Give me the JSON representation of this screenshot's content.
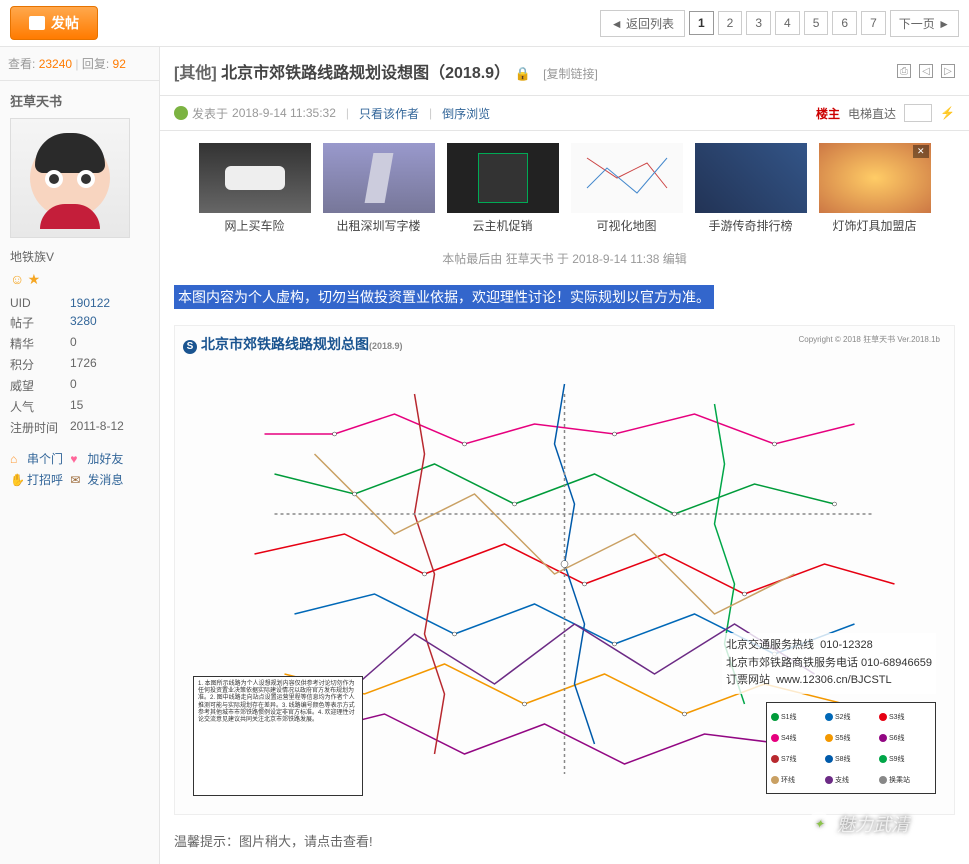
{
  "topbar": {
    "post_button": "发帖",
    "back_list": "◄ 返回列表",
    "pages": [
      "1",
      "2",
      "3",
      "4",
      "5",
      "6",
      "7"
    ],
    "next_page": "下一页 ►"
  },
  "stats": {
    "view_label": "查看:",
    "view_count": "23240",
    "reply_label": "回复:",
    "reply_count": "92"
  },
  "thread": {
    "category": "[其他]",
    "title": "北京市郊铁路线路规划设想图（2018.9）",
    "copy_link": "[复制链接]",
    "posted_prefix": "发表于",
    "posted_time": "2018-9-14 11:35:32",
    "only_author": "只看该作者",
    "reverse": "倒序浏览",
    "floor_master": "楼主",
    "elevator": "电梯直达",
    "edit_note": "本帖最后由 狂草天书 于 2018-9-14 11:38 编辑"
  },
  "user": {
    "name": "狂草天书",
    "level": "地铁族V",
    "stats": [
      {
        "label": "UID",
        "value": "190122"
      },
      {
        "label": "帖子",
        "value": "3280"
      },
      {
        "label": "精华",
        "value": "0"
      },
      {
        "label": "积分",
        "value": "1726"
      },
      {
        "label": "威望",
        "value": "0"
      },
      {
        "label": "人气",
        "value": "15"
      },
      {
        "label": "注册时间",
        "value": "2011-8-12"
      }
    ],
    "actions": {
      "home": "串个门",
      "friend": "加好友",
      "greet": "打招呼",
      "msg": "发消息"
    }
  },
  "ads": [
    {
      "label": "网上买车险"
    },
    {
      "label": "出租深圳写字楼"
    },
    {
      "label": "云主机促销"
    },
    {
      "label": "可视化地图"
    },
    {
      "label": "手游传奇排行榜"
    },
    {
      "label": "灯饰灯具加盟店"
    }
  ],
  "post": {
    "highlight": "本图内容为个人虚构，切勿当做投资置业依据，欢迎理性讨论！实际规划以官方为准。",
    "map_title": "北京市郊铁路线路规划总图",
    "map_hotline_label": "北京交通服务热线",
    "map_hotline": "010-12328",
    "map_service_label": "北京市郊铁路商铁服务电话",
    "map_service": "010-68946659",
    "map_booking_label": "订票网站",
    "map_booking": "www.12306.cn/BJCSTL",
    "map_copyright": "Copyright © 2018 狂草天书 Ver.2018.1b",
    "warm_tip": "温馨提示：图片稍大，请点击查看!"
  },
  "watermark": "魅力武清"
}
